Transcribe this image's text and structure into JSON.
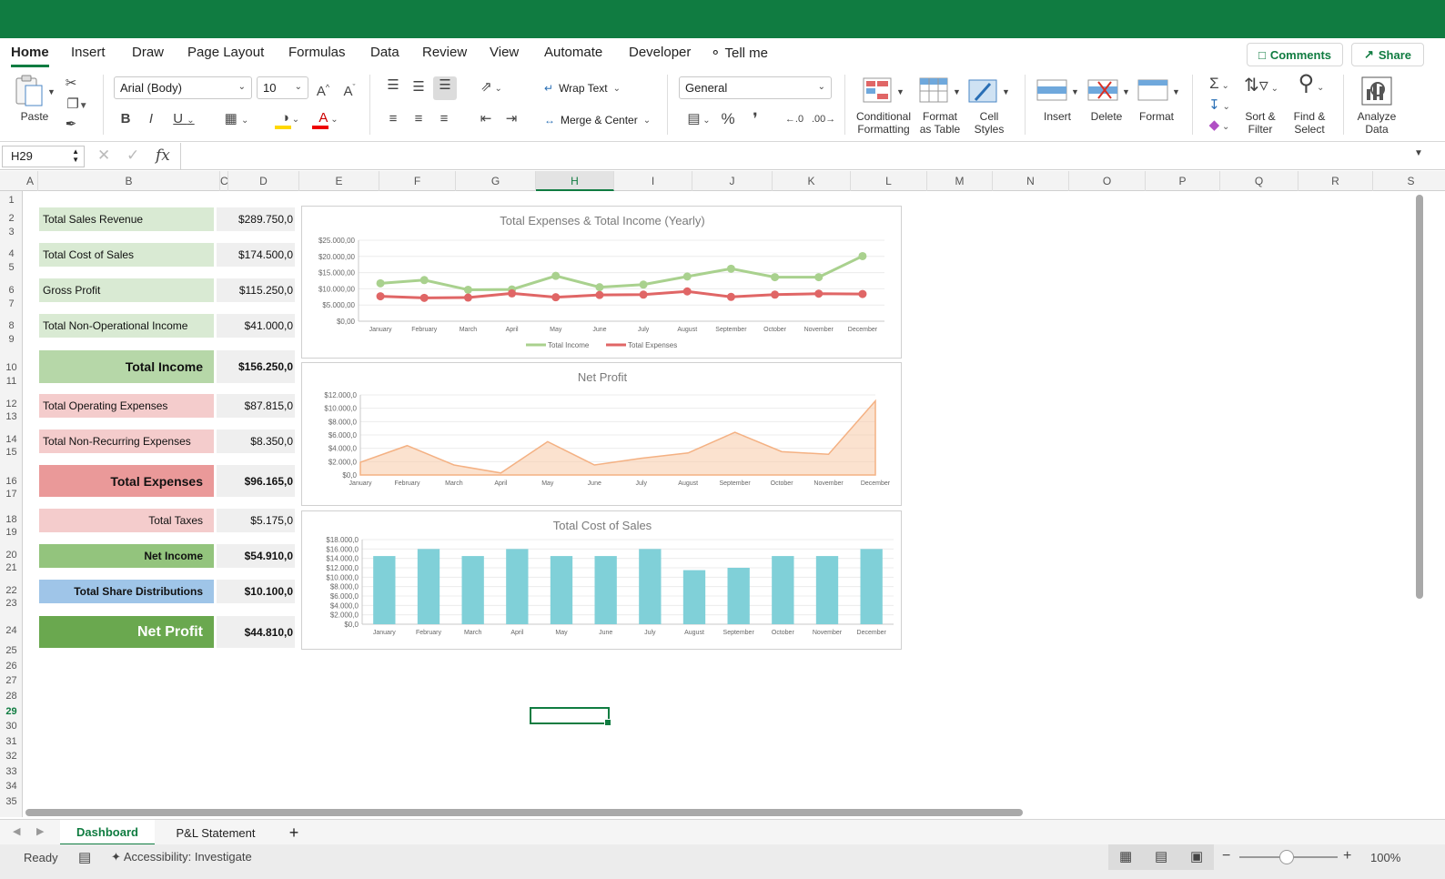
{
  "ribbon_tabs": [
    "Home",
    "Insert",
    "Draw",
    "Page Layout",
    "Formulas",
    "Data",
    "Review",
    "View",
    "Automate",
    "Developer",
    "Tell me"
  ],
  "topright": {
    "comments": "Comments",
    "share": "Share"
  },
  "ribbon": {
    "paste": "Paste",
    "font_name": "Arial (Body)",
    "font_size": "10",
    "wrap_text": "Wrap Text",
    "merge_center": "Merge & Center",
    "number_format": "General",
    "conditional_formatting": [
      "Conditional",
      "Formatting"
    ],
    "format_as_table": [
      "Format",
      "as Table"
    ],
    "cell_styles": [
      "Cell",
      "Styles"
    ],
    "insert": "Insert",
    "delete": "Delete",
    "format": "Format",
    "sort_filter": [
      "Sort &",
      "Filter"
    ],
    "find_select": [
      "Find &",
      "Select"
    ],
    "analyze_data": [
      "Analyze",
      "Data"
    ]
  },
  "formula_bar": {
    "name_box": "H29",
    "fx": "fx",
    "formula": ""
  },
  "columns": [
    "A",
    "B",
    "C",
    "D",
    "E",
    "F",
    "G",
    "H",
    "I",
    "J",
    "K",
    "L",
    "M",
    "N",
    "O",
    "P",
    "Q",
    "R",
    "S"
  ],
  "selected_column": "H",
  "rows": [
    "1",
    "2",
    "3",
    "4",
    "5",
    "6",
    "7",
    "8",
    "9",
    "10",
    "11",
    "12",
    "13",
    "14",
    "15",
    "16",
    "17",
    "18",
    "19",
    "20",
    "21",
    "22",
    "23",
    "24",
    "25",
    "26",
    "27",
    "28",
    "29",
    "30",
    "31",
    "32",
    "33",
    "34",
    "35"
  ],
  "selected_row": "29",
  "summary": [
    {
      "label": "Total Sales Revenue",
      "value": "$289.750,0",
      "fill": "#d9ead3",
      "style": "normal"
    },
    {
      "label": "Total Cost of Sales",
      "value": "$174.500,0",
      "fill": "#d9ead3",
      "style": "normal"
    },
    {
      "label": "Gross Profit",
      "value": "$115.250,0",
      "fill": "#d9ead3",
      "style": "normal"
    },
    {
      "label": "Total Non-Operational Income",
      "value": "$41.000,0",
      "fill": "#d9ead3",
      "style": "normal"
    },
    {
      "label": "Total Income",
      "value": "$156.250,0",
      "fill": "#b6d7a8",
      "style": "total"
    },
    {
      "label": "Total Operating Expenses",
      "value": "$87.815,0",
      "fill": "#f4cccc",
      "style": "normal"
    },
    {
      "label": "Total Non-Recurring Expenses",
      "value": "$8.350,0",
      "fill": "#f4cccc",
      "style": "normal"
    },
    {
      "label": "Total Expenses",
      "value": "$96.165,0",
      "fill": "#ea9999",
      "style": "total"
    },
    {
      "label": "Total Taxes",
      "value": "$5.175,0",
      "fill": "#f4cccc",
      "style": "rightnormal"
    },
    {
      "label": "Net Income",
      "value": "$54.910,0",
      "fill": "#93c47d",
      "style": "rightbold"
    },
    {
      "label": "Total Share Distributions",
      "value": "$10.100,0",
      "fill": "#9fc5e8",
      "style": "rightbold"
    },
    {
      "label": "Net Profit",
      "value": "$44.810,0",
      "fill": "#6aa84f",
      "style": "netprofit"
    }
  ],
  "chart_data": [
    {
      "type": "line",
      "title": "Total Expenses & Total Income (Yearly)",
      "categories": [
        "January",
        "February",
        "March",
        "April",
        "May",
        "June",
        "July",
        "August",
        "September",
        "October",
        "November",
        "December"
      ],
      "y_ticks": [
        "$0,00",
        "$5.000,00",
        "$10.000,00",
        "$15.000,00",
        "$20.000,00",
        "$25.000,00"
      ],
      "ylim": [
        0,
        25000
      ],
      "series": [
        {
          "name": "Total Income",
          "color": "#a9d18e",
          "values": [
            11700,
            12700,
            9700,
            9800,
            14000,
            10500,
            11300,
            13800,
            16200,
            13600,
            13600,
            20100
          ]
        },
        {
          "name": "Total Expenses",
          "color": "#e06666",
          "values": [
            7700,
            7200,
            7300,
            8600,
            7400,
            8100,
            8200,
            9200,
            7500,
            8200,
            8500,
            8400
          ]
        }
      ],
      "legend": "bottom"
    },
    {
      "type": "area",
      "title": "Net Profit",
      "categories": [
        "January",
        "February",
        "March",
        "April",
        "May",
        "June",
        "July",
        "August",
        "September",
        "October",
        "November",
        "December"
      ],
      "y_ticks": [
        "$0,0",
        "$2.000,0",
        "$4.000,0",
        "$6.000,0",
        "$8.000,0",
        "$10.000,0",
        "$12.000,0"
      ],
      "ylim": [
        0,
        12000
      ],
      "color": "#f8cba8",
      "values": [
        1900,
        4400,
        1500,
        300,
        5000,
        1500,
        2500,
        3300,
        6400,
        3500,
        3100,
        11100
      ]
    },
    {
      "type": "bar",
      "title": "Total Cost of Sales",
      "categories": [
        "January",
        "February",
        "March",
        "April",
        "May",
        "June",
        "July",
        "August",
        "September",
        "October",
        "November",
        "December"
      ],
      "y_ticks": [
        "$0,0",
        "$2.000,0",
        "$4.000,0",
        "$6.000,0",
        "$8.000,0",
        "$10.000,0",
        "$12.000,0",
        "$14.000,0",
        "$16.000,0",
        "$18.000,0"
      ],
      "ylim": [
        0,
        18000
      ],
      "color": "#80d0d8",
      "values": [
        14500,
        16000,
        14500,
        16000,
        14500,
        14500,
        16000,
        11500,
        12000,
        14500,
        14500,
        16000
      ]
    }
  ],
  "sheets": [
    "Dashboard",
    "P&L Statement"
  ],
  "add_sheet": "+",
  "status": {
    "ready": "Ready",
    "accessibility": "Accessibility: Investigate",
    "zoom": "100%"
  }
}
